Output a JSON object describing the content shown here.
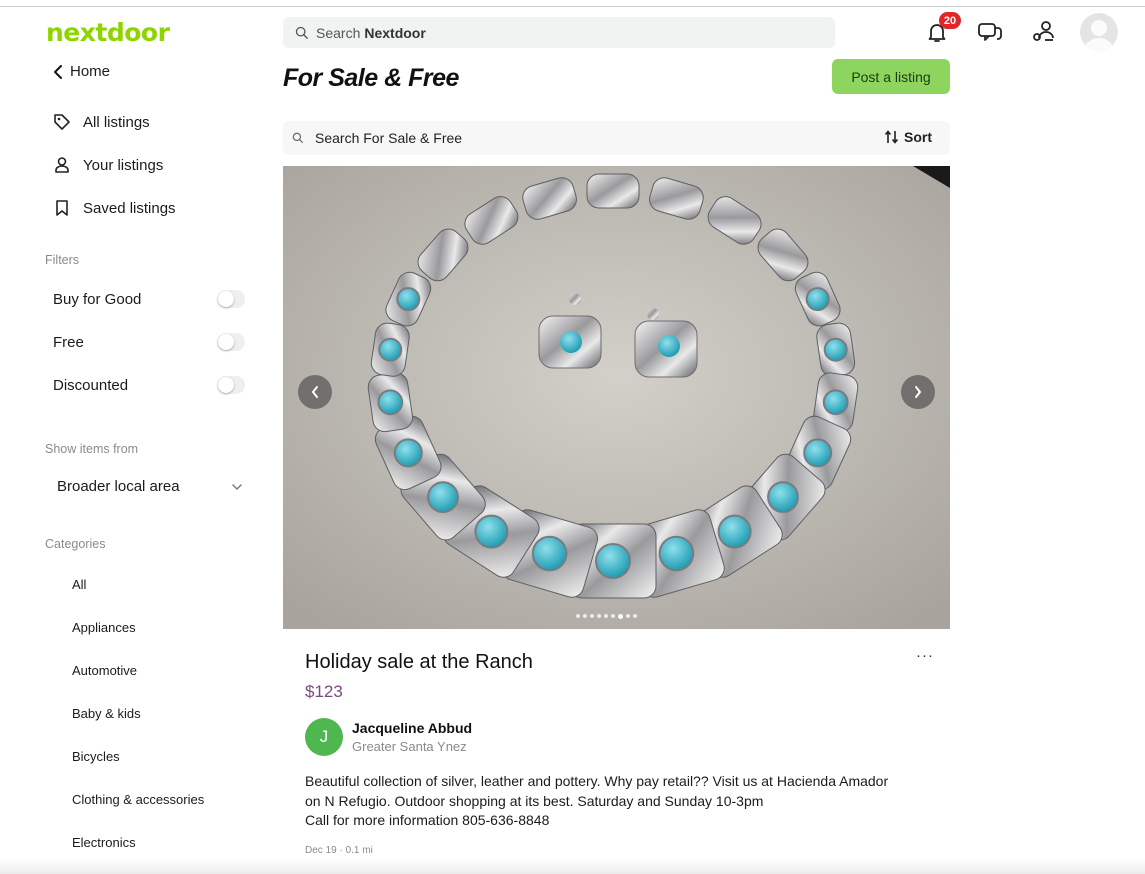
{
  "app": {
    "logo": "nextdoor"
  },
  "header": {
    "search_prefix": "Search",
    "search_bold": "Nextdoor",
    "notification_count": "20",
    "icons": [
      "bell-icon",
      "chat-icon",
      "neighbors-icon",
      "avatar"
    ]
  },
  "sidebar": {
    "back_label": "Home",
    "nav": [
      {
        "label": "All listings",
        "icon": "tag-icon"
      },
      {
        "label": "Your listings",
        "icon": "person-icon"
      },
      {
        "label": "Saved listings",
        "icon": "bookmark-icon"
      }
    ],
    "filters_label": "Filters",
    "filters": [
      {
        "label": "Buy for Good",
        "on": false
      },
      {
        "label": "Free",
        "on": false
      },
      {
        "label": "Discounted",
        "on": false
      }
    ],
    "show_items_label": "Show items from",
    "show_items_value": "Broader local area",
    "categories_label": "Categories",
    "categories": [
      "All",
      "Appliances",
      "Automotive",
      "Baby & kids",
      "Bicycles",
      "Clothing & accessories",
      "Electronics"
    ]
  },
  "main": {
    "title": "For Sale & Free",
    "post_button": "Post a listing",
    "search_placeholder": "Search For Sale & Free",
    "sort_label": "Sort",
    "carousel": {
      "total": 9,
      "active": 7
    },
    "listing": {
      "title": "Holiday sale at the Ranch",
      "price": "$123",
      "more": "···",
      "seller_initial": "J",
      "seller_name": "Jacqueline Abbud",
      "seller_location": "Greater Santa Ynez",
      "description_1": "Beautiful collection of silver, leather and pottery. Why pay retail??  Visit us at Hacienda Amador",
      "description_2": "on N Refugio. Outdoor shopping at its best. Saturday and Sunday 10-3pm",
      "description_3": "Call for more information 805-636-8848",
      "meta": "Dec 19 · 0.1 mi"
    }
  },
  "colors": {
    "brand": "#8ed500",
    "post_button": "#8dd55f",
    "badge": "#e0262a",
    "price": "#7a4b7d",
    "seller_avatar": "#4fb750"
  }
}
